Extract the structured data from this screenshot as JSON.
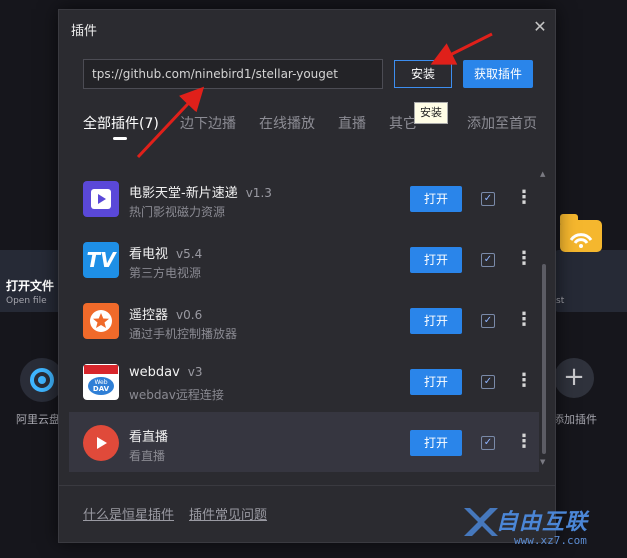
{
  "background": {
    "open_file_title": "打开文件",
    "open_file_sub": "Open file",
    "aliyun_label": "阿里云盘",
    "add_plugin_label": "添加插件",
    "right_card_text": "st"
  },
  "dialog": {
    "title": "插件",
    "close_icon": "close-icon",
    "url_value": "tps://github.com/ninebird1/stellar-youget",
    "install_label": "安装",
    "get_plugins_label": "获取插件",
    "tooltip": "安装",
    "tabs": [
      {
        "label": "全部插件(7)",
        "active": true
      },
      {
        "label": "边下边播",
        "active": false
      },
      {
        "label": "在线播放",
        "active": false
      },
      {
        "label": "直播",
        "active": false
      },
      {
        "label": "其它",
        "active": false
      },
      {
        "label": "添加至首页",
        "active": false
      }
    ],
    "plugins": [
      {
        "name": "电影天堂-新片速递",
        "version": "v1.3",
        "desc": "热门影视磁力资源",
        "open_label": "打开",
        "checked": true,
        "icon": "movie-play-icon"
      },
      {
        "name": "看电视",
        "version": "v5.4",
        "desc": "第三方电视源",
        "open_label": "打开",
        "checked": true,
        "icon": "tv-icon"
      },
      {
        "name": "遥控器",
        "version": "v0.6",
        "desc": "通过手机控制播放器",
        "open_label": "打开",
        "checked": true,
        "icon": "remote-star-icon"
      },
      {
        "name": "webdav",
        "version": "v3",
        "desc": "webdav远程连接",
        "open_label": "打开",
        "checked": true,
        "icon": "webdav-icon"
      },
      {
        "name": "看直播",
        "version": "",
        "desc": "看直播",
        "open_label": "打开",
        "checked": true,
        "icon": "live-play-icon"
      }
    ],
    "footer": {
      "what_is": "什么是恒星插件",
      "faq": "插件常见问题"
    }
  },
  "watermark": {
    "text": "自由互联",
    "url": "www.xz7.com"
  },
  "colors": {
    "accent": "#2a85ea",
    "arrow": "#e0201a",
    "dialog_bg": "#2b2b30"
  }
}
